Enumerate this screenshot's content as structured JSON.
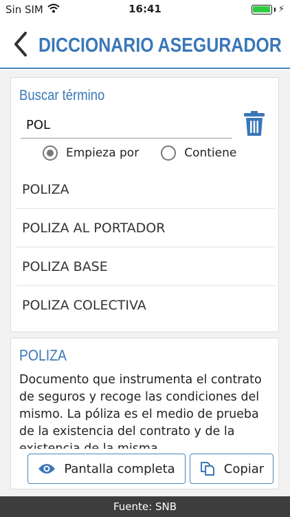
{
  "status_bar": {
    "carrier": "Sin SIM",
    "time": "16:41",
    "battery_level": 1.0
  },
  "header": {
    "title": "DICCIONARIO ASEGURADOR"
  },
  "search": {
    "label": "Buscar término",
    "value": "POL",
    "options": [
      {
        "label": "Empieza por",
        "selected": true
      },
      {
        "label": "Contiene",
        "selected": false
      }
    ]
  },
  "results": [
    "POLIZA",
    "POLIZA AL PORTADOR",
    "POLIZA BASE",
    "POLIZA COLECTIVA"
  ],
  "definition": {
    "term": "POLIZA",
    "text": "Documento que instrumenta el contrato de seguros y recoge las condiciones del mismo. La póliza es el medio de prueba de la existencia del contrato y de la existencia de la misma."
  },
  "actions": {
    "fullscreen_label": "Pantalla completa",
    "copy_label": "Copiar"
  },
  "footer": {
    "source": "Fuente: SNB"
  },
  "colors": {
    "accent": "#3a77b8",
    "footer_bg": "#3d3d3d",
    "battery": "#2ecc40"
  }
}
